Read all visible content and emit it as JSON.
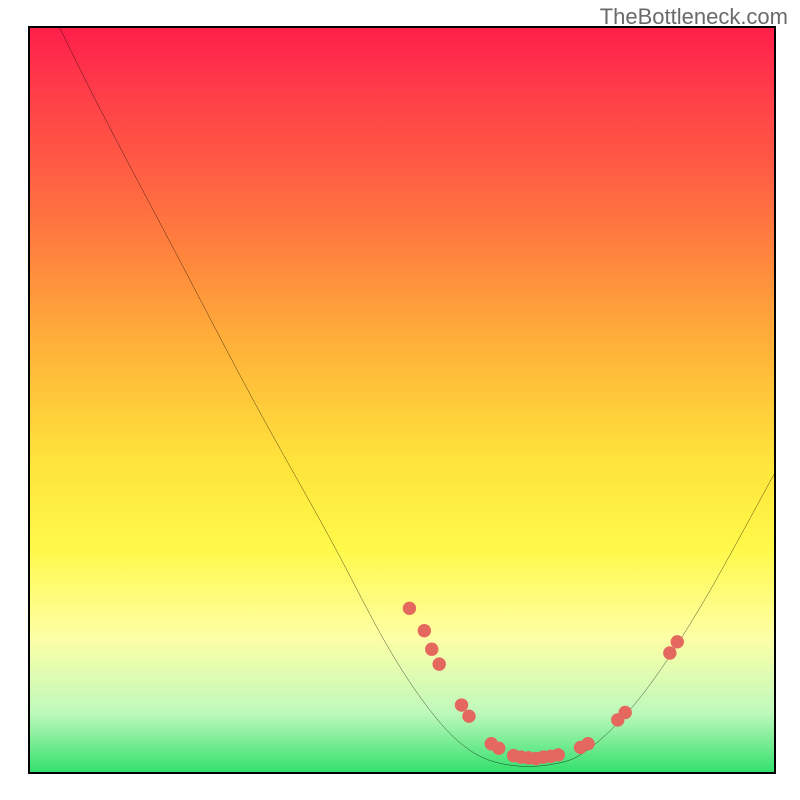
{
  "watermark": "TheBottleneck.com",
  "chart_data": {
    "type": "line",
    "title": "",
    "xlabel": "",
    "ylabel": "",
    "xlim": [
      0,
      100
    ],
    "ylim": [
      0,
      100
    ],
    "grid": false,
    "legend": false,
    "curve": [
      {
        "x": 4,
        "y": 100
      },
      {
        "x": 10,
        "y": 88
      },
      {
        "x": 20,
        "y": 69
      },
      {
        "x": 30,
        "y": 50
      },
      {
        "x": 40,
        "y": 32
      },
      {
        "x": 48,
        "y": 17
      },
      {
        "x": 54,
        "y": 8
      },
      {
        "x": 59,
        "y": 3
      },
      {
        "x": 64,
        "y": 1
      },
      {
        "x": 70,
        "y": 1
      },
      {
        "x": 75,
        "y": 3
      },
      {
        "x": 82,
        "y": 10
      },
      {
        "x": 90,
        "y": 22
      },
      {
        "x": 100,
        "y": 40
      }
    ],
    "markers": [
      {
        "x": 51,
        "y": 22
      },
      {
        "x": 53,
        "y": 19
      },
      {
        "x": 54,
        "y": 16.5
      },
      {
        "x": 55,
        "y": 14.5
      },
      {
        "x": 58,
        "y": 9
      },
      {
        "x": 59,
        "y": 7.5
      },
      {
        "x": 62,
        "y": 3.8
      },
      {
        "x": 63,
        "y": 3.2
      },
      {
        "x": 65,
        "y": 2.2
      },
      {
        "x": 66,
        "y": 2.0
      },
      {
        "x": 67,
        "y": 1.9
      },
      {
        "x": 68,
        "y": 1.8
      },
      {
        "x": 69,
        "y": 2.0
      },
      {
        "x": 70,
        "y": 2.1
      },
      {
        "x": 71,
        "y": 2.3
      },
      {
        "x": 74,
        "y": 3.3
      },
      {
        "x": 75,
        "y": 3.8
      },
      {
        "x": 79,
        "y": 7
      },
      {
        "x": 80,
        "y": 8
      },
      {
        "x": 86,
        "y": 16
      },
      {
        "x": 87,
        "y": 17.5
      }
    ],
    "marker_color": "#e4685e"
  }
}
